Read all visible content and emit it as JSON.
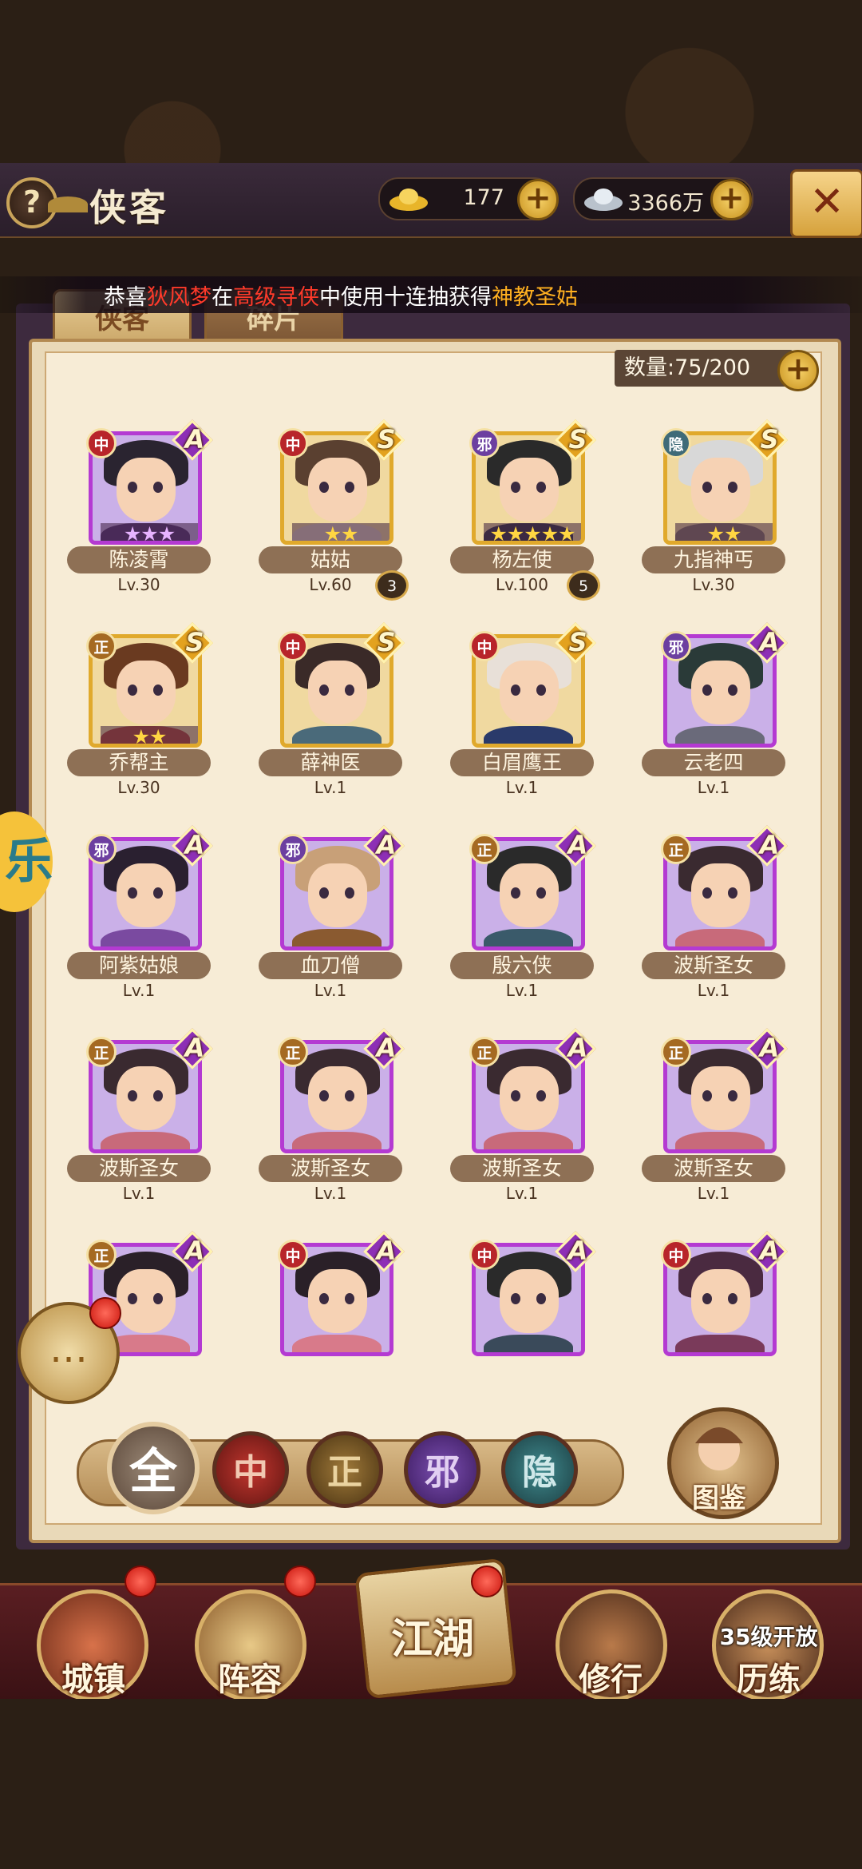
{
  "header": {
    "help_label": "?",
    "title": "侠客",
    "gold_value": "177",
    "silver_value": "3366万",
    "plus_label": "+",
    "close_label": "✕"
  },
  "broadcast": {
    "part1": "恭喜",
    "player": "狄风梦",
    "part2": "在",
    "mode": "高级寻侠",
    "part3": "中使用十连抽获得",
    "reward": "神教圣姑"
  },
  "tabs": [
    {
      "label": "侠客",
      "active": true
    },
    {
      "label": "碎片",
      "active": false
    }
  ],
  "count_label": "数量:75/200",
  "heroes": [
    {
      "name": "陈凌霄",
      "level": "Lv.30",
      "faction": "中",
      "grade": "A",
      "stars": "★★★",
      "badge": ""
    },
    {
      "name": "姑姑",
      "level": "Lv.60",
      "faction": "中",
      "grade": "S",
      "stars": "★★",
      "badge": "3"
    },
    {
      "name": "杨左使",
      "level": "Lv.100",
      "faction": "邪",
      "grade": "S",
      "stars": "★★★★★",
      "badge": "5"
    },
    {
      "name": "九指神丐",
      "level": "Lv.30",
      "faction": "隐",
      "grade": "S",
      "stars": "★★",
      "badge": ""
    },
    {
      "name": "乔帮主",
      "level": "Lv.30",
      "faction": "正",
      "grade": "S",
      "stars": "★★",
      "badge": ""
    },
    {
      "name": "薛神医",
      "level": "Lv.1",
      "faction": "中",
      "grade": "S",
      "stars": "",
      "badge": ""
    },
    {
      "name": "白眉鹰王",
      "level": "Lv.1",
      "faction": "中",
      "grade": "S",
      "stars": "",
      "badge": ""
    },
    {
      "name": "云老四",
      "level": "Lv.1",
      "faction": "邪",
      "grade": "A",
      "stars": "",
      "badge": ""
    },
    {
      "name": "阿紫姑娘",
      "level": "Lv.1",
      "faction": "邪",
      "grade": "A",
      "stars": "",
      "badge": ""
    },
    {
      "name": "血刀僧",
      "level": "Lv.1",
      "faction": "邪",
      "grade": "A",
      "stars": "",
      "badge": ""
    },
    {
      "name": "殷六侠",
      "level": "Lv.1",
      "faction": "正",
      "grade": "A",
      "stars": "",
      "badge": ""
    },
    {
      "name": "波斯圣女",
      "level": "Lv.1",
      "faction": "正",
      "grade": "A",
      "stars": "",
      "badge": ""
    },
    {
      "name": "波斯圣女",
      "level": "Lv.1",
      "faction": "正",
      "grade": "A",
      "stars": "",
      "badge": ""
    },
    {
      "name": "波斯圣女",
      "level": "Lv.1",
      "faction": "正",
      "grade": "A",
      "stars": "",
      "badge": ""
    },
    {
      "name": "波斯圣女",
      "level": "Lv.1",
      "faction": "正",
      "grade": "A",
      "stars": "",
      "badge": ""
    },
    {
      "name": "波斯圣女",
      "level": "Lv.1",
      "faction": "正",
      "grade": "A",
      "stars": "",
      "badge": ""
    },
    {
      "name": "",
      "level": "",
      "faction": "正",
      "grade": "A",
      "stars": "",
      "badge": ""
    },
    {
      "name": "",
      "level": "",
      "faction": "中",
      "grade": "A",
      "stars": "",
      "badge": ""
    },
    {
      "name": "",
      "level": "",
      "faction": "中",
      "grade": "A",
      "stars": "",
      "badge": ""
    },
    {
      "name": "",
      "level": "",
      "faction": "中",
      "grade": "A",
      "stars": "",
      "badge": ""
    }
  ],
  "filters": {
    "all": "全",
    "zhong": "中",
    "zheng": "正",
    "xie": "邪",
    "yin": "隐",
    "codex": "图鉴"
  },
  "chat_icon": "…",
  "side_tab_label": "乐",
  "nav": {
    "town": "城镇",
    "lineup": "阵容",
    "jianghu": "江湖",
    "training": "修行",
    "trial": "历练",
    "trial_lock": "35级开放"
  }
}
